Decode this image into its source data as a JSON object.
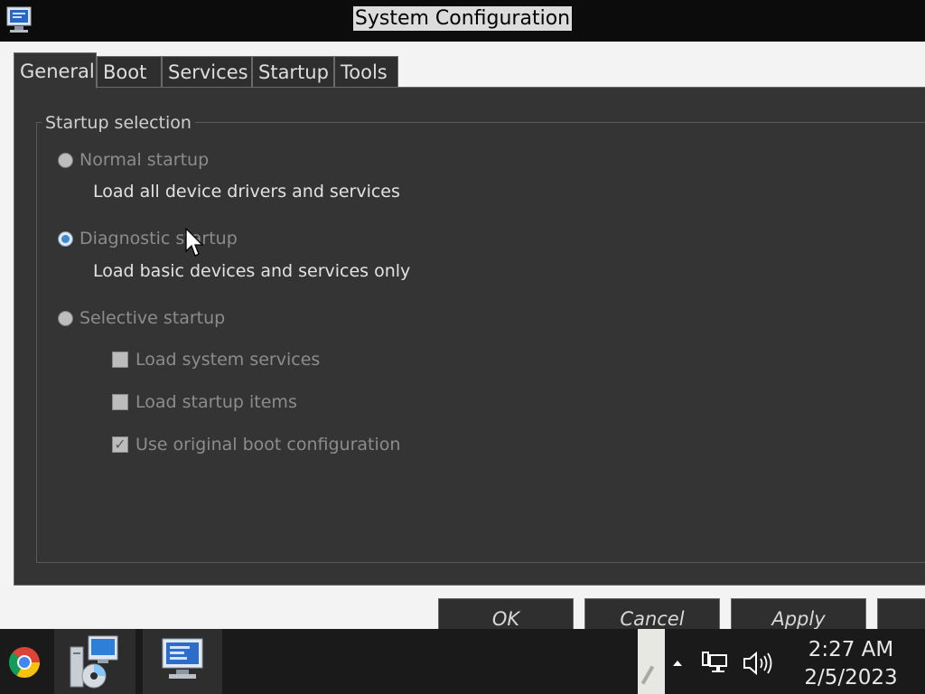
{
  "window": {
    "title": "System Configuration"
  },
  "tabs": [
    {
      "label": "General",
      "active": true
    },
    {
      "label": "Boot",
      "active": false
    },
    {
      "label": "Services",
      "active": false
    },
    {
      "label": "Startup",
      "active": false
    },
    {
      "label": "Tools",
      "active": false
    }
  ],
  "startup_selection": {
    "legend": "Startup selection",
    "normal": {
      "label": "Normal startup",
      "description": "Load all device drivers and services",
      "selected": false
    },
    "diagnostic": {
      "label": "Diagnostic startup",
      "description": "Load basic devices and services only",
      "selected": true
    },
    "selective": {
      "label": "Selective startup",
      "selected": false,
      "options": [
        {
          "label": "Load system services",
          "checked": false
        },
        {
          "label": "Load startup items",
          "checked": false
        },
        {
          "label": "Use original boot configuration",
          "checked": true
        }
      ]
    }
  },
  "buttons": {
    "ok": "OK",
    "cancel": "Cancel",
    "apply": "Apply"
  },
  "taskbar": {
    "items": [
      "chrome-icon",
      "installer-icon",
      "system-configuration-icon"
    ],
    "tray_icons": [
      "show-hidden-icons-arrow-icon",
      "network-icon",
      "volume-icon"
    ],
    "clock": {
      "time": "2:27 AM",
      "date": "2/5/2023"
    }
  },
  "colors": {
    "accent": "#3a8ad4",
    "panel": "#343434",
    "taskbar": "#1a1a1a"
  }
}
